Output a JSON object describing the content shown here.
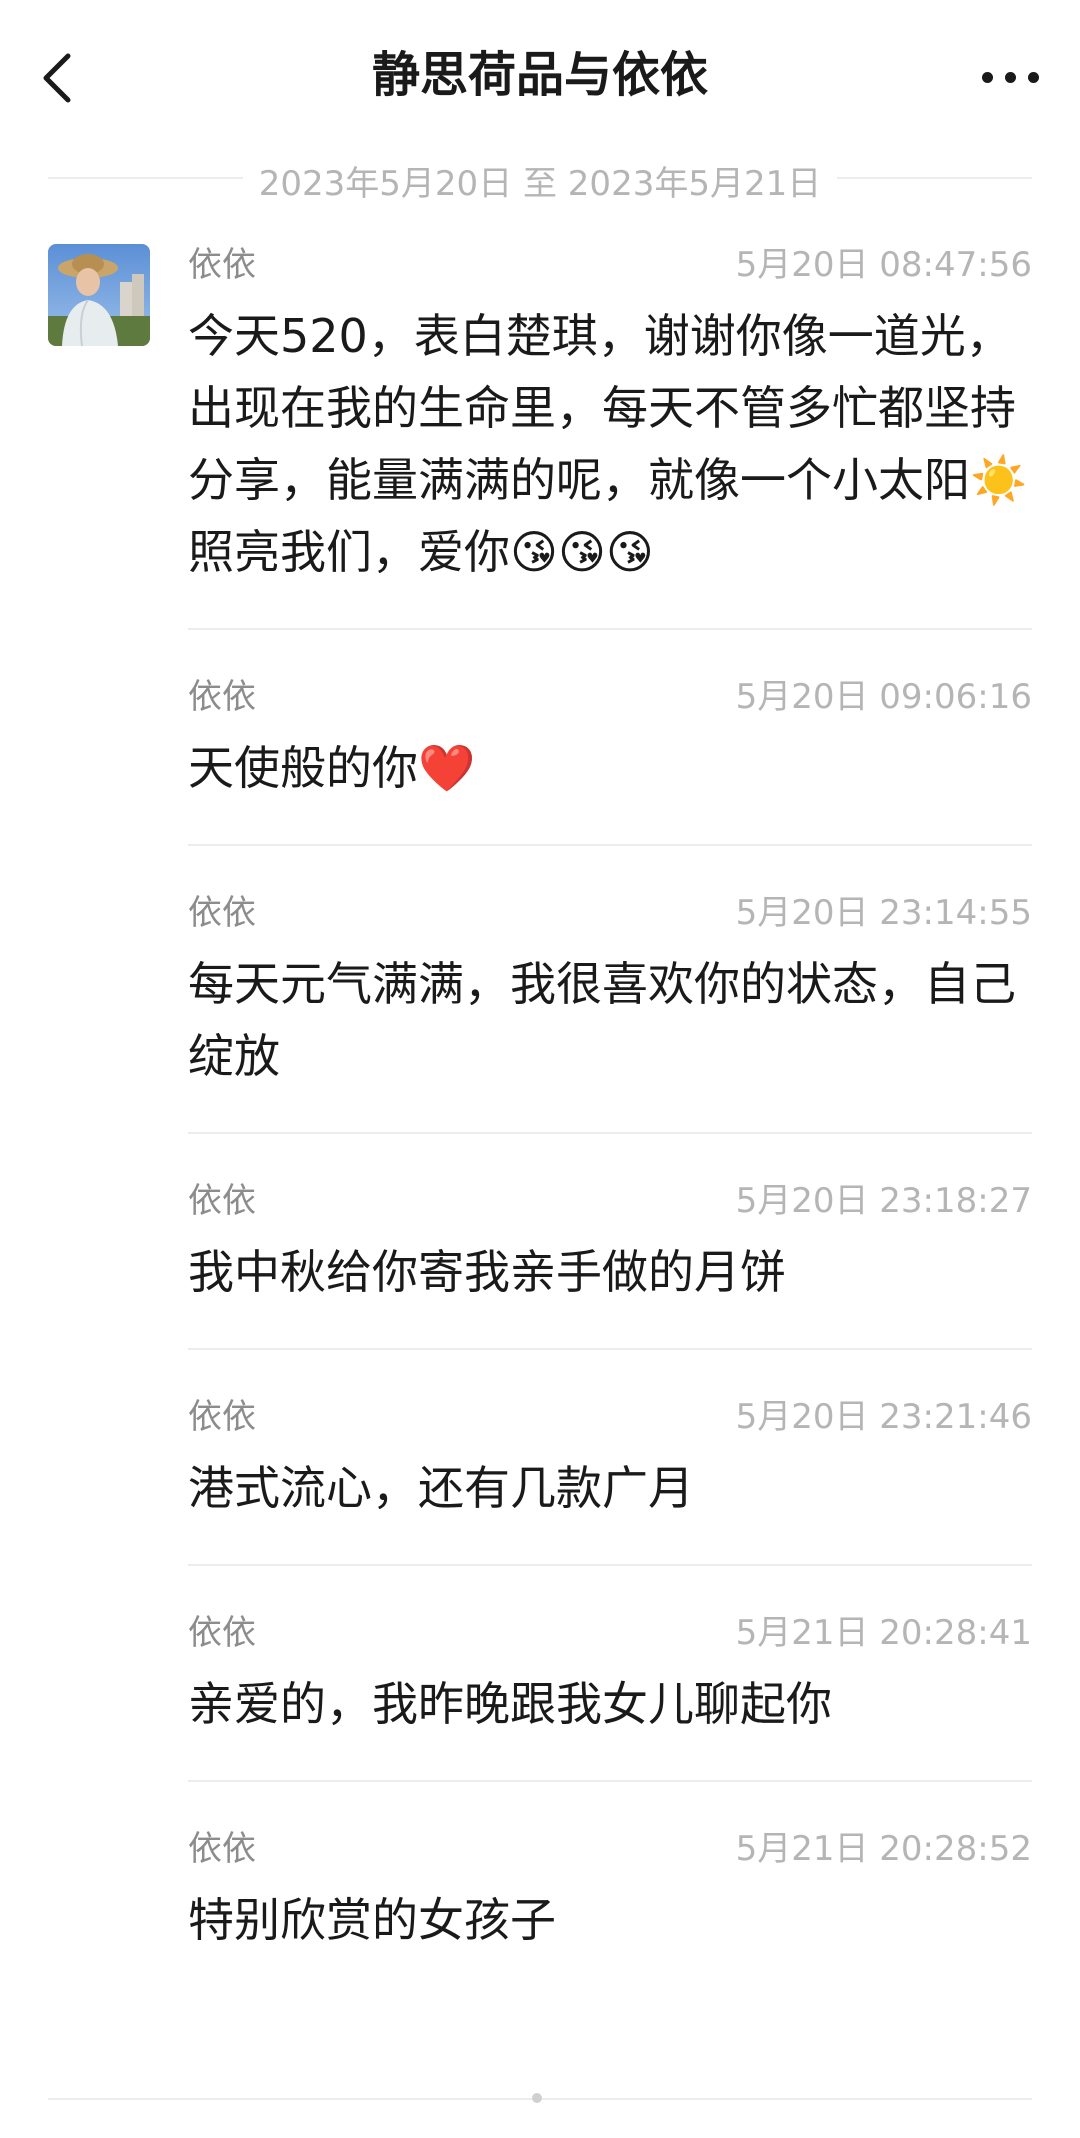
{
  "header": {
    "title": "静思荷品与依依"
  },
  "date_range": "2023年5月20日 至 2023年5月21日",
  "icons": {
    "back": "chevron-left-icon",
    "more": "more-dots-icon"
  },
  "messages": [
    {
      "sender": "依依",
      "time": "5月20日 08:47:56",
      "text": "今天520，表白楚琪，谢谢你像一道光，出现在我的生命里，每天不管多忙都坚持分享，能量满满的呢，就像一个小太阳☀️照亮我们，爱你😘😘😘"
    },
    {
      "sender": "依依",
      "time": "5月20日 09:06:16",
      "text": "天使般的你❤️"
    },
    {
      "sender": "依依",
      "time": "5月20日 23:14:55",
      "text": "每天元气满满，我很喜欢你的状态，自己绽放"
    },
    {
      "sender": "依依",
      "time": "5月20日 23:18:27",
      "text": "我中秋给你寄我亲手做的月饼"
    },
    {
      "sender": "依依",
      "time": "5月20日 23:21:46",
      "text": "港式流心，还有几款广月"
    },
    {
      "sender": "依依",
      "time": "5月21日 20:28:41",
      "text": "亲爱的，我昨晚跟我女儿聊起你"
    },
    {
      "sender": "依依",
      "time": "5月21日 20:28:52",
      "text": "特别欣赏的女孩子"
    }
  ]
}
